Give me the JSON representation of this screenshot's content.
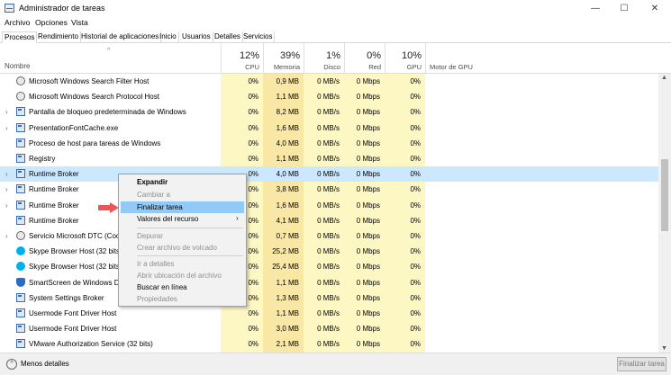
{
  "window": {
    "title": "Administrador de tareas",
    "minimize": "—",
    "maximize": "☐",
    "close": "✕"
  },
  "menu": [
    "Archivo",
    "Opciones",
    "Vista"
  ],
  "tabs": [
    "Procesos",
    "Rendimiento",
    "Historial de aplicaciones",
    "Inicio",
    "Usuarios",
    "Detalles",
    "Servicios"
  ],
  "header": {
    "sort_caret": "^",
    "name_label": "Nombre",
    "cpu": {
      "pct": "12%",
      "label": "CPU"
    },
    "mem": {
      "pct": "39%",
      "label": "Memoria"
    },
    "disk": {
      "pct": "1%",
      "label": "Disco"
    },
    "net": {
      "pct": "0%",
      "label": "Red"
    },
    "gpu": {
      "pct": "10%",
      "label": "GPU"
    },
    "gpu_engine": {
      "label": "Motor de GPU"
    }
  },
  "rows": [
    {
      "expand": "",
      "icon": "gear-icon",
      "name": "Microsoft Windows Search Filter Host",
      "cpu": "0%",
      "mem": "0,9 MB",
      "disk": "0 MB/s",
      "net": "0 Mbps",
      "gpu": "0%"
    },
    {
      "expand": "",
      "icon": "gear-icon",
      "name": "Microsoft Windows Search Protocol Host",
      "cpu": "0%",
      "mem": "1,1 MB",
      "disk": "0 MB/s",
      "net": "0 Mbps",
      "gpu": "0%"
    },
    {
      "expand": "›",
      "icon": "window-icon",
      "name": "Pantalla de bloqueo predeterminada de Windows",
      "cpu": "0%",
      "mem": "8,2 MB",
      "disk": "0 MB/s",
      "net": "0 Mbps",
      "gpu": "0%"
    },
    {
      "expand": "›",
      "icon": "window-icon",
      "name": "PresentationFontCache.exe",
      "cpu": "0%",
      "mem": "1,6 MB",
      "disk": "0 MB/s",
      "net": "0 Mbps",
      "gpu": "0%"
    },
    {
      "expand": "",
      "icon": "window-icon",
      "name": "Proceso de host para tareas de Windows",
      "cpu": "0%",
      "mem": "4,0 MB",
      "disk": "0 MB/s",
      "net": "0 Mbps",
      "gpu": "0%"
    },
    {
      "expand": "",
      "icon": "window-icon",
      "name": "Registry",
      "cpu": "0%",
      "mem": "1,1 MB",
      "disk": "0 MB/s",
      "net": "0 Mbps",
      "gpu": "0%"
    },
    {
      "expand": "›",
      "icon": "window-icon",
      "name": "Runtime Broker",
      "cpu": "0%",
      "mem": "4,0 MB",
      "disk": "0 MB/s",
      "net": "0 Mbps",
      "gpu": "0%",
      "selected": true
    },
    {
      "expand": "›",
      "icon": "window-icon",
      "name": "Runtime Broker",
      "cpu": "0%",
      "mem": "3,8 MB",
      "disk": "0 MB/s",
      "net": "0 Mbps",
      "gpu": "0%"
    },
    {
      "expand": "›",
      "icon": "window-icon",
      "name": "Runtime Broker",
      "cpu": "0%",
      "mem": "1,6 MB",
      "disk": "0 MB/s",
      "net": "0 Mbps",
      "gpu": "0%"
    },
    {
      "expand": "",
      "icon": "window-icon",
      "name": "Runtime Broker",
      "cpu": "0%",
      "mem": "4,1 MB",
      "disk": "0 MB/s",
      "net": "0 Mbps",
      "gpu": "0%"
    },
    {
      "expand": "›",
      "icon": "gear-icon",
      "name": "Servicio Microsoft DTC (Coord",
      "cpu": "0%",
      "mem": "0,7 MB",
      "disk": "0 MB/s",
      "net": "0 Mbps",
      "gpu": "0%"
    },
    {
      "expand": "",
      "icon": "skype-icon",
      "name": "Skype Browser Host (32 bits)",
      "cpu": "0%",
      "mem": "25,2 MB",
      "disk": "0 MB/s",
      "net": "0 Mbps",
      "gpu": "0%"
    },
    {
      "expand": "",
      "icon": "skype-icon",
      "name": "Skype Browser Host (32 bits)",
      "cpu": "0%",
      "mem": "25,4 MB",
      "disk": "0 MB/s",
      "net": "0 Mbps",
      "gpu": "0%"
    },
    {
      "expand": "",
      "icon": "shield-icon",
      "name": "SmartScreen de Windows Defe",
      "cpu": "0%",
      "mem": "1,1 MB",
      "disk": "0 MB/s",
      "net": "0 Mbps",
      "gpu": "0%"
    },
    {
      "expand": "",
      "icon": "window-icon",
      "name": "System Settings Broker",
      "cpu": "0%",
      "mem": "1,3 MB",
      "disk": "0 MB/s",
      "net": "0 Mbps",
      "gpu": "0%"
    },
    {
      "expand": "",
      "icon": "window-icon",
      "name": "Usermode Font Driver Host",
      "cpu": "0%",
      "mem": "1,1 MB",
      "disk": "0 MB/s",
      "net": "0 Mbps",
      "gpu": "0%"
    },
    {
      "expand": "",
      "icon": "window-icon",
      "name": "Usermode Font Driver Host",
      "cpu": "0%",
      "mem": "3,0 MB",
      "disk": "0 MB/s",
      "net": "0 Mbps",
      "gpu": "0%"
    },
    {
      "expand": "",
      "icon": "window-icon",
      "name": "VMware Authorization Service (32 bits)",
      "cpu": "0%",
      "mem": "2,1 MB",
      "disk": "0 MB/s",
      "net": "0 Mbps",
      "gpu": "0%"
    }
  ],
  "context_menu": {
    "expandir": "Expandir",
    "cambiar": "Cambiar a",
    "finalizar": "Finalizar tarea",
    "valores": "Valores del recurso",
    "submenu_arrow": "›",
    "depurar": "Depurar",
    "crear_volcado": "Crear archivo de volcado",
    "ir_detalles": "Ir a detalles",
    "abrir_ubicacion": "Abrir ubicación del archivo",
    "buscar": "Buscar en línea",
    "propiedades": "Propiedades"
  },
  "scrollbar": {
    "up": "▲",
    "down": "▼"
  },
  "footer": {
    "chevron": "^",
    "menos": "Menos detalles",
    "finalizar": "Finalizar tarea"
  },
  "colors": {
    "selection": "#cce8ff",
    "highlight": "#91c9f7",
    "heat_light": "#fdf7c4",
    "heat_mem": "#f9e7a6",
    "arrow": "#e8585a"
  }
}
